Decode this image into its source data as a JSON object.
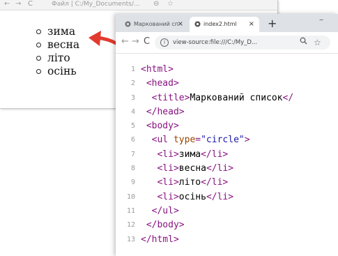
{
  "background_window": {
    "toolbar": {
      "back": "←",
      "forward": "→",
      "reload": "C",
      "url": "Файл | C:/My_Documents/...",
      "zoom": "⊖",
      "star": "☆"
    },
    "list_items": [
      "зима",
      "весна",
      "літо",
      "осінь"
    ]
  },
  "arrow_color": "#e23b2e",
  "browser": {
    "tabs": [
      {
        "title": "Маркований сп",
        "close": "×",
        "active": false
      },
      {
        "title": "index2.html",
        "close": "×",
        "active": true
      }
    ],
    "new_tab": "+",
    "minimize": "–",
    "nav": {
      "back": "←",
      "forward": "→",
      "reload": "C"
    },
    "address": "view-source:file:///C:/My_D...",
    "info": "i",
    "zoom_icon": "🔍",
    "star_icon": "☆"
  },
  "source_lines": [
    {
      "n": "1",
      "indent": "",
      "parts": [
        {
          "c": "tag",
          "t": "<html>"
        }
      ]
    },
    {
      "n": "2",
      "indent": " ",
      "parts": [
        {
          "c": "tag",
          "t": "<head>"
        }
      ]
    },
    {
      "n": "3",
      "indent": "  ",
      "parts": [
        {
          "c": "tag",
          "t": "<title>"
        },
        {
          "c": "txt",
          "t": "Маркований список"
        },
        {
          "c": "tag",
          "t": "</"
        }
      ]
    },
    {
      "n": "4",
      "indent": " ",
      "parts": [
        {
          "c": "tag",
          "t": "</head>"
        }
      ]
    },
    {
      "n": "5",
      "indent": " ",
      "parts": [
        {
          "c": "tag",
          "t": "<body>"
        }
      ]
    },
    {
      "n": "6",
      "indent": "  ",
      "parts": [
        {
          "c": "tag",
          "t": "<ul "
        },
        {
          "c": "attr",
          "t": "type"
        },
        {
          "c": "tag",
          "t": "="
        },
        {
          "c": "val",
          "t": "\"circle\""
        },
        {
          "c": "tag",
          "t": ">"
        }
      ]
    },
    {
      "n": "7",
      "indent": "   ",
      "parts": [
        {
          "c": "tag",
          "t": "<li>"
        },
        {
          "c": "txt",
          "t": "зима"
        },
        {
          "c": "tag",
          "t": "</li>"
        }
      ]
    },
    {
      "n": "8",
      "indent": "   ",
      "parts": [
        {
          "c": "tag",
          "t": "<li>"
        },
        {
          "c": "txt",
          "t": "весна"
        },
        {
          "c": "tag",
          "t": "</li>"
        }
      ]
    },
    {
      "n": "9",
      "indent": "   ",
      "parts": [
        {
          "c": "tag",
          "t": "<li>"
        },
        {
          "c": "txt",
          "t": "літо"
        },
        {
          "c": "tag",
          "t": "</li>"
        }
      ]
    },
    {
      "n": "10",
      "indent": "   ",
      "parts": [
        {
          "c": "tag",
          "t": "<li>"
        },
        {
          "c": "txt",
          "t": "осінь"
        },
        {
          "c": "tag",
          "t": "</li>"
        }
      ]
    },
    {
      "n": "11",
      "indent": "  ",
      "parts": [
        {
          "c": "tag",
          "t": "</ul>"
        }
      ]
    },
    {
      "n": "12",
      "indent": " ",
      "parts": [
        {
          "c": "tag",
          "t": "</body>"
        }
      ]
    },
    {
      "n": "13",
      "indent": "",
      "parts": [
        {
          "c": "tag",
          "t": "</html>"
        }
      ]
    }
  ]
}
